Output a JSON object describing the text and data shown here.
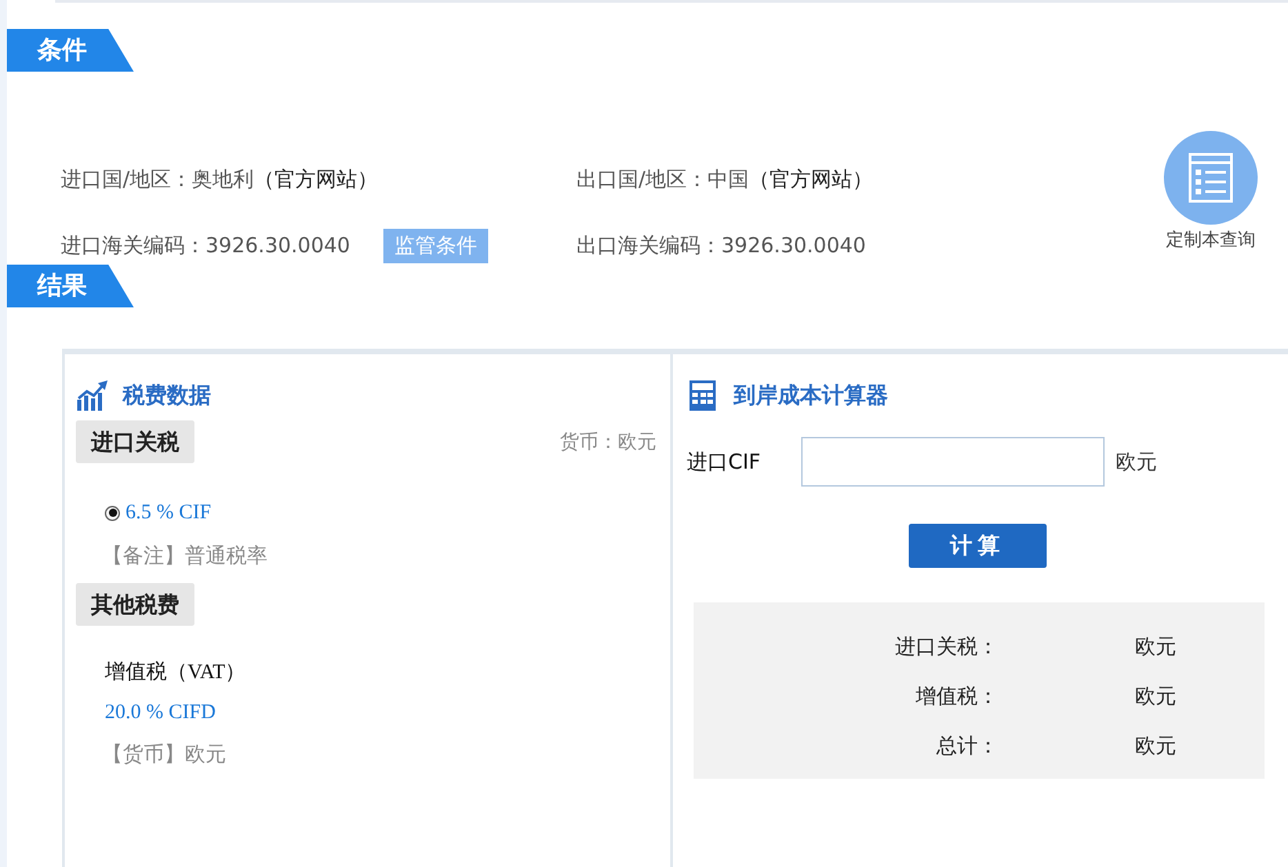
{
  "conditions": {
    "title": "条件",
    "fields": [
      {
        "label": "进口国/地区：",
        "value": "奥地利",
        "link": "（官方网站）"
      },
      {
        "label": "出口国/地区：",
        "value": "中国",
        "link": "（官方网站）"
      },
      {
        "label": "进口海关编码：",
        "value": "3926.30.0040",
        "button": "监管条件"
      },
      {
        "label": "出口海关编码：",
        "value": "3926.30.0040"
      }
    ],
    "custom_query": "定制本查询"
  },
  "results": {
    "title": "结果",
    "tax_data": {
      "title": "税费数据",
      "import_duty": {
        "title": "进口关税",
        "currency": "货币：欧元",
        "rates": [
          {
            "text": "6.5 % CIF",
            "selected": true
          }
        ],
        "note": "【备注】普通税率"
      },
      "other_taxes": {
        "title": "其他税费",
        "items": [
          {
            "name": "增值税（VAT）",
            "rate": "20.0 % CIFD",
            "currency": "【货币】欧元"
          }
        ]
      }
    },
    "calculator": {
      "title": "到岸成本计算器",
      "input_label": "进口CIF",
      "input_unit": "欧元",
      "button": "计算",
      "results": [
        {
          "label": "进口关税：",
          "unit": "欧元"
        },
        {
          "label": "增值税：",
          "unit": "欧元"
        },
        {
          "label": "总计：",
          "unit": "欧元"
        }
      ]
    }
  }
}
